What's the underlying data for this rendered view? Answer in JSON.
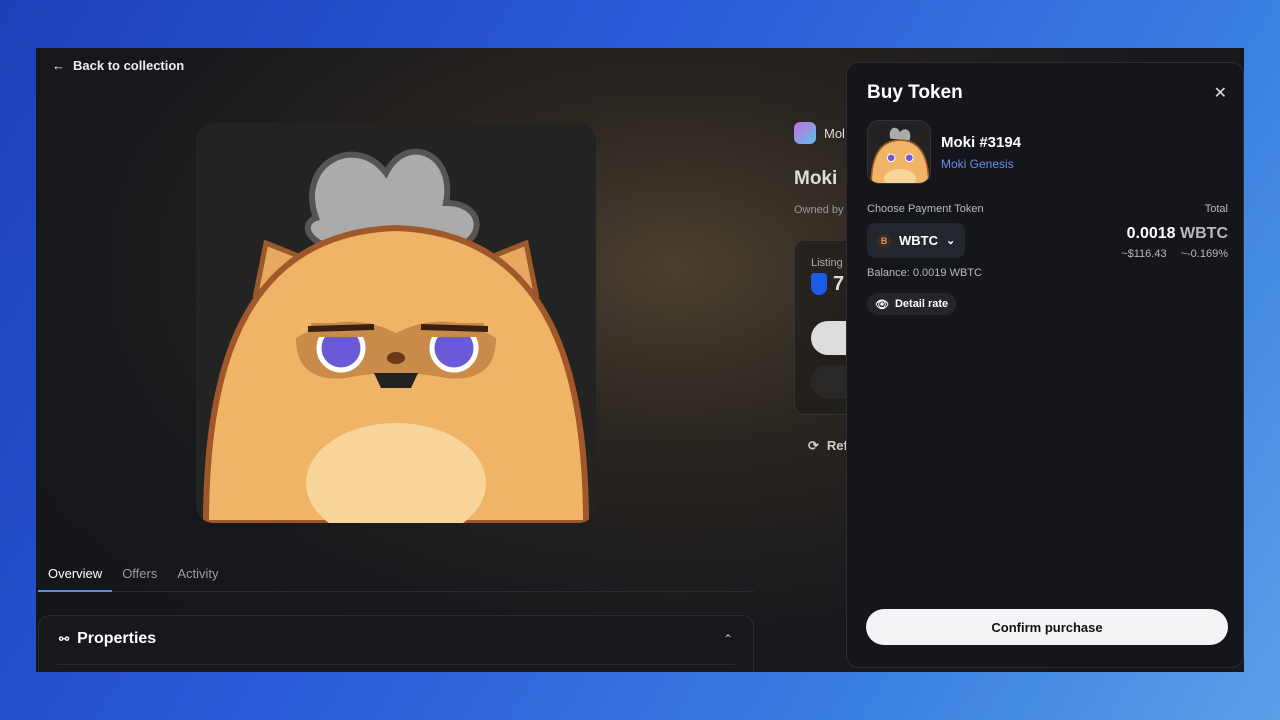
{
  "nav": {
    "back_label": "Back to collection"
  },
  "detail": {
    "collection_short": "Mol",
    "title_short": "Moki",
    "owned_short": "Owned by",
    "listing_short": "Listing",
    "price_short": "7",
    "refresh_short": "Ref"
  },
  "tabs": [
    {
      "label": "Overview",
      "active": true
    },
    {
      "label": "Offers"
    },
    {
      "label": "Activity"
    }
  ],
  "properties": {
    "title": "Properties"
  },
  "buy_panel": {
    "title": "Buy Token",
    "token_name": "Moki #3194",
    "collection": "Moki Genesis",
    "payment_label": "Choose Payment Token",
    "payment_token": "WBTC",
    "balance": "Balance: 0.0019 WBTC",
    "total_label": "Total",
    "total_amount": "0.0018",
    "total_unit": "WBTC",
    "total_usd": "~$116.43",
    "total_change": "~-0.169%",
    "detail_rate": "Detail rate",
    "confirm": "Confirm purchase"
  },
  "colors": {
    "accent": "#5a8cf0",
    "collection_link": "#6a8ee8",
    "btc": "#e3915a"
  }
}
